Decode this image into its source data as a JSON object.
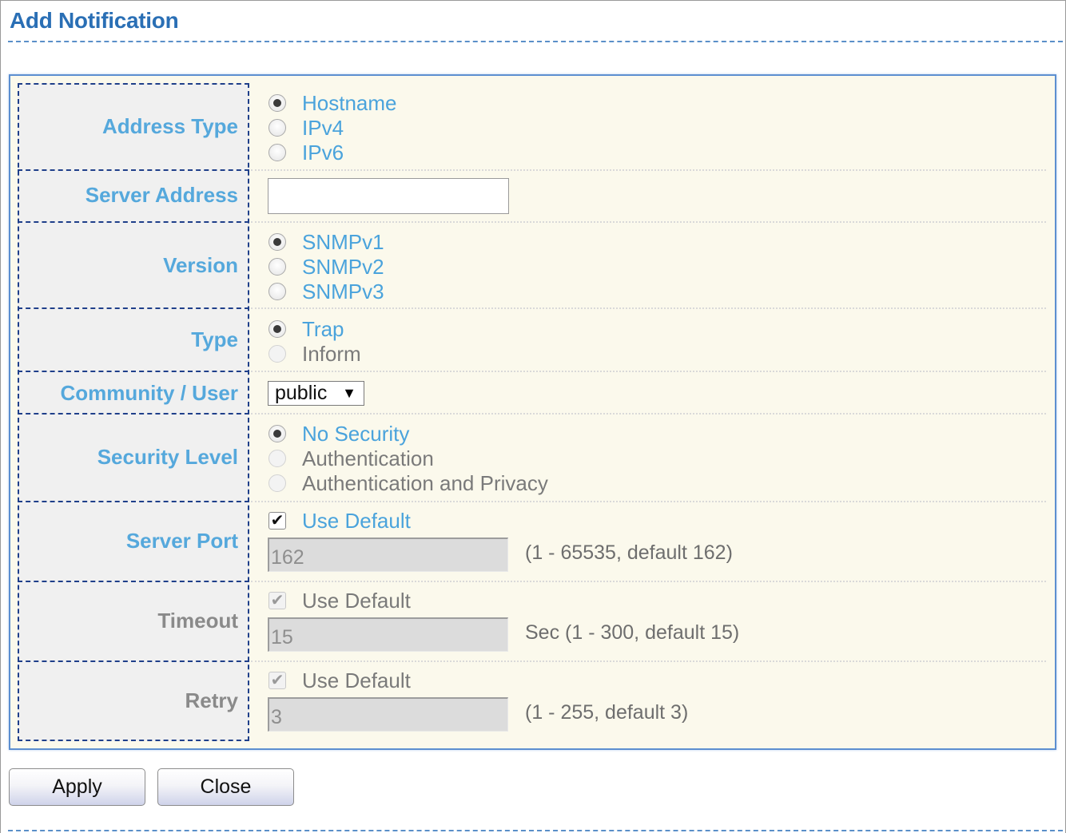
{
  "page": {
    "title": "Add Notification"
  },
  "form": {
    "address_type": {
      "label": "Address Type",
      "options": [
        {
          "label": "Hostname",
          "checked": true
        },
        {
          "label": "IPv4",
          "checked": false
        },
        {
          "label": "IPv6",
          "checked": false
        }
      ]
    },
    "server_address": {
      "label": "Server Address",
      "value": ""
    },
    "version": {
      "label": "Version",
      "options": [
        {
          "label": "SNMPv1",
          "checked": true
        },
        {
          "label": "SNMPv2",
          "checked": false
        },
        {
          "label": "SNMPv3",
          "checked": false
        }
      ]
    },
    "type": {
      "label": "Type",
      "options": [
        {
          "label": "Trap",
          "checked": true
        },
        {
          "label": "Inform",
          "checked": false,
          "disabled": true
        }
      ]
    },
    "community_user": {
      "label": "Community / User",
      "selected": "public"
    },
    "security_level": {
      "label": "Security Level",
      "options": [
        {
          "label": "No Security",
          "checked": true
        },
        {
          "label": "Authentication",
          "checked": false,
          "disabled": true
        },
        {
          "label": "Authentication and Privacy",
          "checked": false,
          "disabled": true
        }
      ]
    },
    "server_port": {
      "label": "Server Port",
      "use_default_label": "Use Default",
      "use_default_checked": true,
      "value": "162",
      "hint": "(1 - 65535, default 162)"
    },
    "timeout": {
      "label": "Timeout",
      "use_default_label": "Use Default",
      "use_default_checked": true,
      "value": "15",
      "hint": "Sec (1 - 300, default 15)"
    },
    "retry": {
      "label": "Retry",
      "use_default_label": "Use Default",
      "use_default_checked": true,
      "value": "3",
      "hint": "(1 - 255, default 3)"
    }
  },
  "buttons": {
    "apply": "Apply",
    "close": "Close"
  },
  "colors": {
    "label_blue": "#55a8dc",
    "option_blue": "#4aa3dc",
    "title_blue": "#2a6fb5",
    "panel_bg": "#fbf9ec"
  },
  "icons": {
    "select_caret": "▼",
    "checkmark": "✔"
  }
}
